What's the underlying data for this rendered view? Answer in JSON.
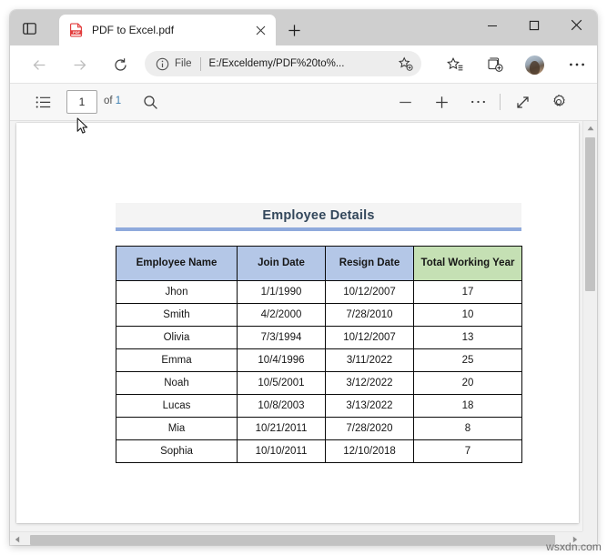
{
  "window": {
    "controls": {
      "minimize": "minimize-button",
      "maximize": "maximize-button",
      "close": "close-button"
    }
  },
  "tab_strip": {
    "sidebar_icon": "tab-sidebar-icon",
    "new_tab_icon": "plus-icon",
    "tab": {
      "favicon": "pdf-file-icon",
      "title": "PDF to Excel.pdf",
      "close_icon": "close-icon"
    }
  },
  "nav_bar": {
    "back_icon": "arrow-left-icon",
    "forward_icon": "arrow-right-icon",
    "reload_icon": "reload-icon",
    "address": {
      "info_icon": "info-circle-icon",
      "scheme_label": "File",
      "url": "E:/Exceldemy/PDF%20to%...",
      "favorite_icon": "star-add-icon"
    },
    "favorites_icon": "favorites-star-icon",
    "collections_icon": "collections-add-icon",
    "profile_icon": "profile-avatar-icon",
    "more_icon": "more-horizontal-icon"
  },
  "pdf_toolbar": {
    "toc_icon": "table-of-contents-icon",
    "page_number": "1",
    "page_total_prefix": "of",
    "page_total": "1",
    "find_icon": "search-icon",
    "zoom_out_icon": "minus-icon",
    "zoom_in_icon": "plus-icon",
    "more_icon": "more-horizontal-icon",
    "fit_page_icon": "fit-to-page-icon",
    "settings_icon": "gear-icon"
  },
  "document": {
    "title": "Employee Details",
    "columns": [
      "Employee Name",
      "Join Date",
      "Resign Date",
      "Total Working Year"
    ],
    "rows": [
      [
        "Jhon",
        "1/1/1990",
        "10/12/2007",
        "17"
      ],
      [
        "Smith",
        "4/2/2000",
        "7/28/2010",
        "10"
      ],
      [
        "Olivia",
        "7/3/1994",
        "10/12/2007",
        "13"
      ],
      [
        "Emma",
        "10/4/1996",
        "3/11/2022",
        "25"
      ],
      [
        "Noah",
        "10/5/2001",
        "3/12/2022",
        "20"
      ],
      [
        "Lucas",
        "10/8/2003",
        "3/13/2022",
        "18"
      ],
      [
        "Mia",
        "10/21/2011",
        "7/28/2020",
        "8"
      ],
      [
        "Sophia",
        "10/10/2011",
        "12/10/2018",
        "7"
      ]
    ],
    "colors": {
      "header_blue": "#b4c7e7",
      "header_green": "#c5e0b4",
      "title_underline": "#8faadc",
      "title_text": "#33475b"
    }
  },
  "scrollbars": {
    "vertical_up_icon": "caret-up-icon",
    "horizontal_left_icon": "caret-left-icon",
    "horizontal_right_icon": "caret-right-icon"
  },
  "watermark": "wsxdn.com"
}
